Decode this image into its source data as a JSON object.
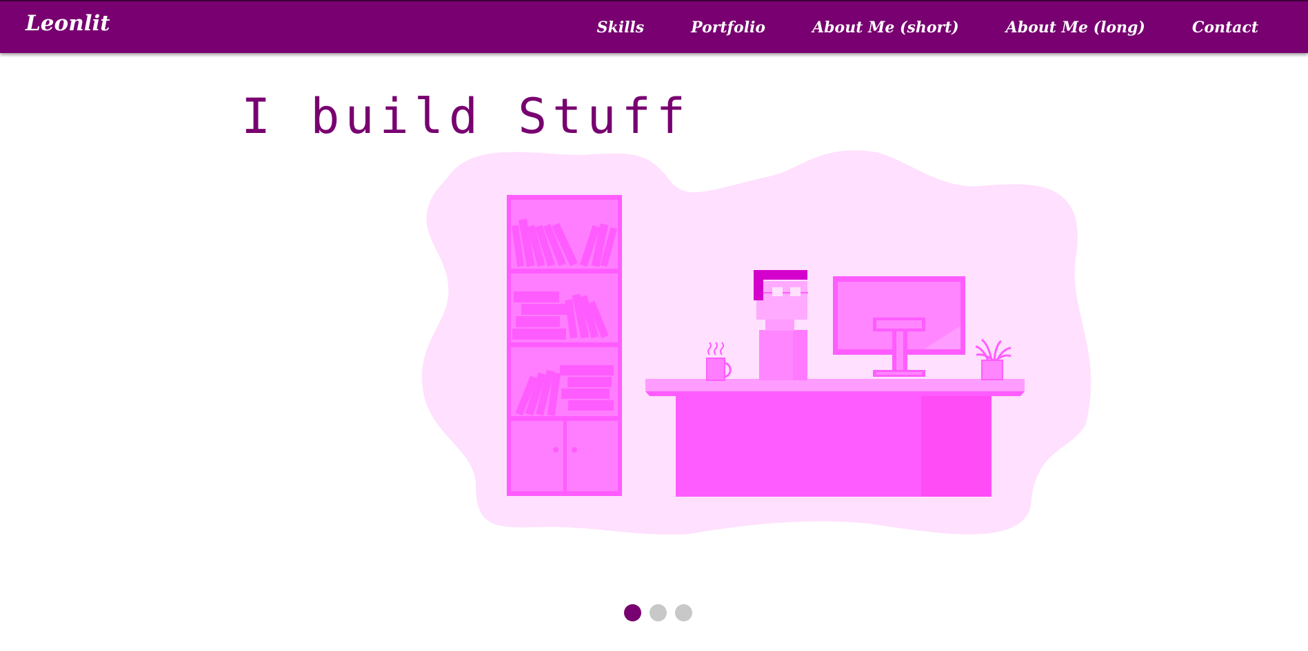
{
  "brand": {
    "name": "Leonlit"
  },
  "nav": {
    "items": [
      {
        "label": "Skills"
      },
      {
        "label": "Portfolio"
      },
      {
        "label": "About Me (short)"
      },
      {
        "label": "About Me (long)"
      },
      {
        "label": "Contact"
      }
    ]
  },
  "hero": {
    "headline": "I build Stuff",
    "illustration_icon": "developer-at-desk-illustration"
  },
  "carousel": {
    "slide_count": 3,
    "active_index": 0
  },
  "colors": {
    "primary": "#780070",
    "illustration_bg": "#ffe0fe",
    "illustration_main": "#ff5cff",
    "inactive_dot": "#c8c8c8"
  }
}
